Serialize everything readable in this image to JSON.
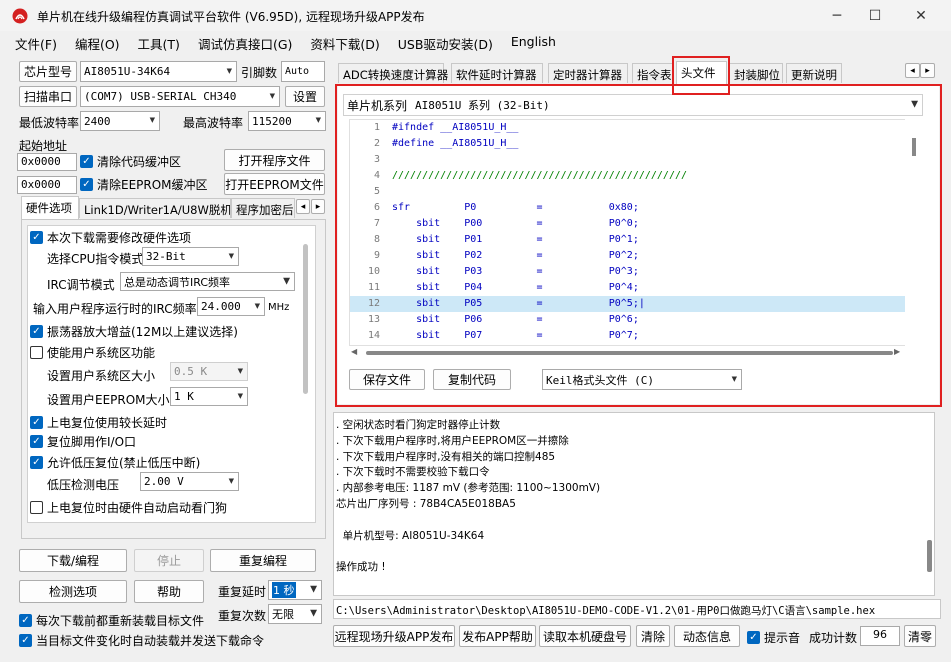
{
  "window": {
    "title": "单片机在线升级编程仿真调试平台软件 (V6.95D), 远程现场升级APP发布",
    "minimize": "─",
    "maximize": "☐",
    "close": "✕"
  },
  "menu": [
    "文件(F)",
    "编程(O)",
    "工具(T)",
    "调试仿真接口(G)",
    "资料下载(D)",
    "USB驱动安装(D)",
    "English"
  ],
  "left": {
    "chip_model_btn": "芯片型号",
    "chip_model": "AI8051U-34K64",
    "pin_count_label": "引脚数",
    "pin_count": "Auto",
    "scan_port_btn": "扫描串口",
    "port": "(COM7) USB-SERIAL CH340",
    "settings_btn": "设置",
    "min_baud_label": "最低波特率",
    "min_baud": "2400",
    "max_baud_label": "最高波特率",
    "max_baud": "115200",
    "start_addr_label": "起始地址",
    "addr1": "0x0000",
    "clear_code_buf": "清除代码缓冲区",
    "open_program_btn": "打开程序文件",
    "addr2": "0x0000",
    "clear_eeprom_buf": "清除EEPROM缓冲区",
    "open_eeprom_btn": "打开EEPROM文件",
    "tabs": [
      "硬件选项",
      "Link1D/Writer1A/U8W脱机",
      "程序加密后"
    ],
    "tab_prev": "◂",
    "tab_next": "▸",
    "hw": {
      "modify_hw": "本次下载需要修改硬件选项",
      "cpu_mode_label": "选择CPU指令模式",
      "cpu_mode": "32-Bit",
      "irc_mode_label": "IRC调节模式",
      "irc_mode": "总是动态调节IRC频率",
      "irc_freq_label": "输入用户程序运行时的IRC频率",
      "irc_freq": "24.000",
      "irc_unit": "MHz",
      "osc_gain": "振荡器放大增益(12M以上建议选择)",
      "sys_area": "使能用户系统区功能",
      "sys_size_label": "设置用户系统区大小",
      "sys_size": "0.5 K",
      "eeprom_size_label": "设置用户EEPROM大小",
      "eeprom_size": "1   K",
      "long_reset": "上电复位使用较长延时",
      "reset_io": "复位脚用作I/O口",
      "low_volt_reset": "允许低压复位(禁止低压中断)",
      "low_volt_label": "低压检测电压",
      "low_volt": "2.00 V",
      "watchdog": "上电复位时由硬件自动启动看门狗"
    },
    "download_btn": "下载/编程",
    "stop_btn": "停止",
    "reprogram_btn": "重复编程",
    "check_btn": "检测选项",
    "help_btn": "帮助",
    "repeat_delay_label": "重复延时",
    "repeat_delay": "1 秒",
    "repeat_count_label": "重复次数",
    "repeat_count": "无限",
    "reload_each": "每次下载前都重新装载目标文件",
    "auto_load": "当目标文件变化时自动装载并发送下载命令"
  },
  "right": {
    "tabs": [
      "ADC转换速度计算器",
      "软件延时计算器",
      "定时器计算器",
      "指令表",
      "头文件",
      "封装脚位",
      "更新说明"
    ],
    "tab_prev": "◂",
    "tab_next": "▸",
    "mcu_series_label": "单片机系列",
    "mcu_series": "AI8051U 系列 (32-Bit)",
    "code_lines": [
      {
        "n": "1",
        "t": "#ifndef __AI8051U_H__"
      },
      {
        "n": "2",
        "t": "#define __AI8051U_H__"
      },
      {
        "n": "3",
        "t": ""
      },
      {
        "n": "4",
        "t": "/////////////////////////////////////////////////"
      },
      {
        "n": "5",
        "t": ""
      },
      {
        "n": "6",
        "t": "sfr         P0          =           0x80;"
      },
      {
        "n": "7",
        "t": "    sbit    P00         =           P0^0;"
      },
      {
        "n": "8",
        "t": "    sbit    P01         =           P0^1;"
      },
      {
        "n": "9",
        "t": "    sbit    P02         =           P0^2;"
      },
      {
        "n": "10",
        "t": "    sbit    P03         =           P0^3;"
      },
      {
        "n": "11",
        "t": "    sbit    P04         =           P0^4;"
      },
      {
        "n": "12",
        "t": "    sbit    P05         =           P0^5;|"
      },
      {
        "n": "13",
        "t": "    sbit    P06         =           P0^6;"
      },
      {
        "n": "14",
        "t": "    sbit    P07         =           P0^7;"
      }
    ],
    "save_file_btn": "保存文件",
    "copy_code_btn": "复制代码",
    "header_format": "Keil格式头文件 (C)"
  },
  "log": [
    ". 空闲状态时看门狗定时器停止计数",
    ". 下次下载用户程序时,将用户EEPROM区一并擦除",
    ". 下次下载用户程序时,没有相关的端口控制485",
    ". 下次下载时不需要校验下载口令",
    ". 内部参考电压: 1187 mV (参考范围: 1100~1300mV)",
    "芯片出厂序列号 : 78B4CA5E018BA5",
    "",
    "  单片机型号: AI8051U-34K64",
    "",
    "操作成功 !"
  ],
  "path": "C:\\Users\\Administrator\\Desktop\\AI8051U-DEMO-CODE-V1.2\\01-用P0口做跑马灯\\C语言\\sample.hex",
  "bottom": {
    "publish_btn": "远程现场升级APP发布",
    "publish_help_btn": "发布APP帮助",
    "read_disk_btn": "读取本机硬盘号",
    "clear_btn": "清除",
    "anim_btn": "动态信息",
    "beep": "提示音",
    "success_label": "成功计数",
    "success_count": "96",
    "clear_count_btn": "清零"
  },
  "colors": {
    "highlight_red": "#e02020",
    "selection_blue": "#cde8f7",
    "checkbox_blue": "#0067c0"
  }
}
